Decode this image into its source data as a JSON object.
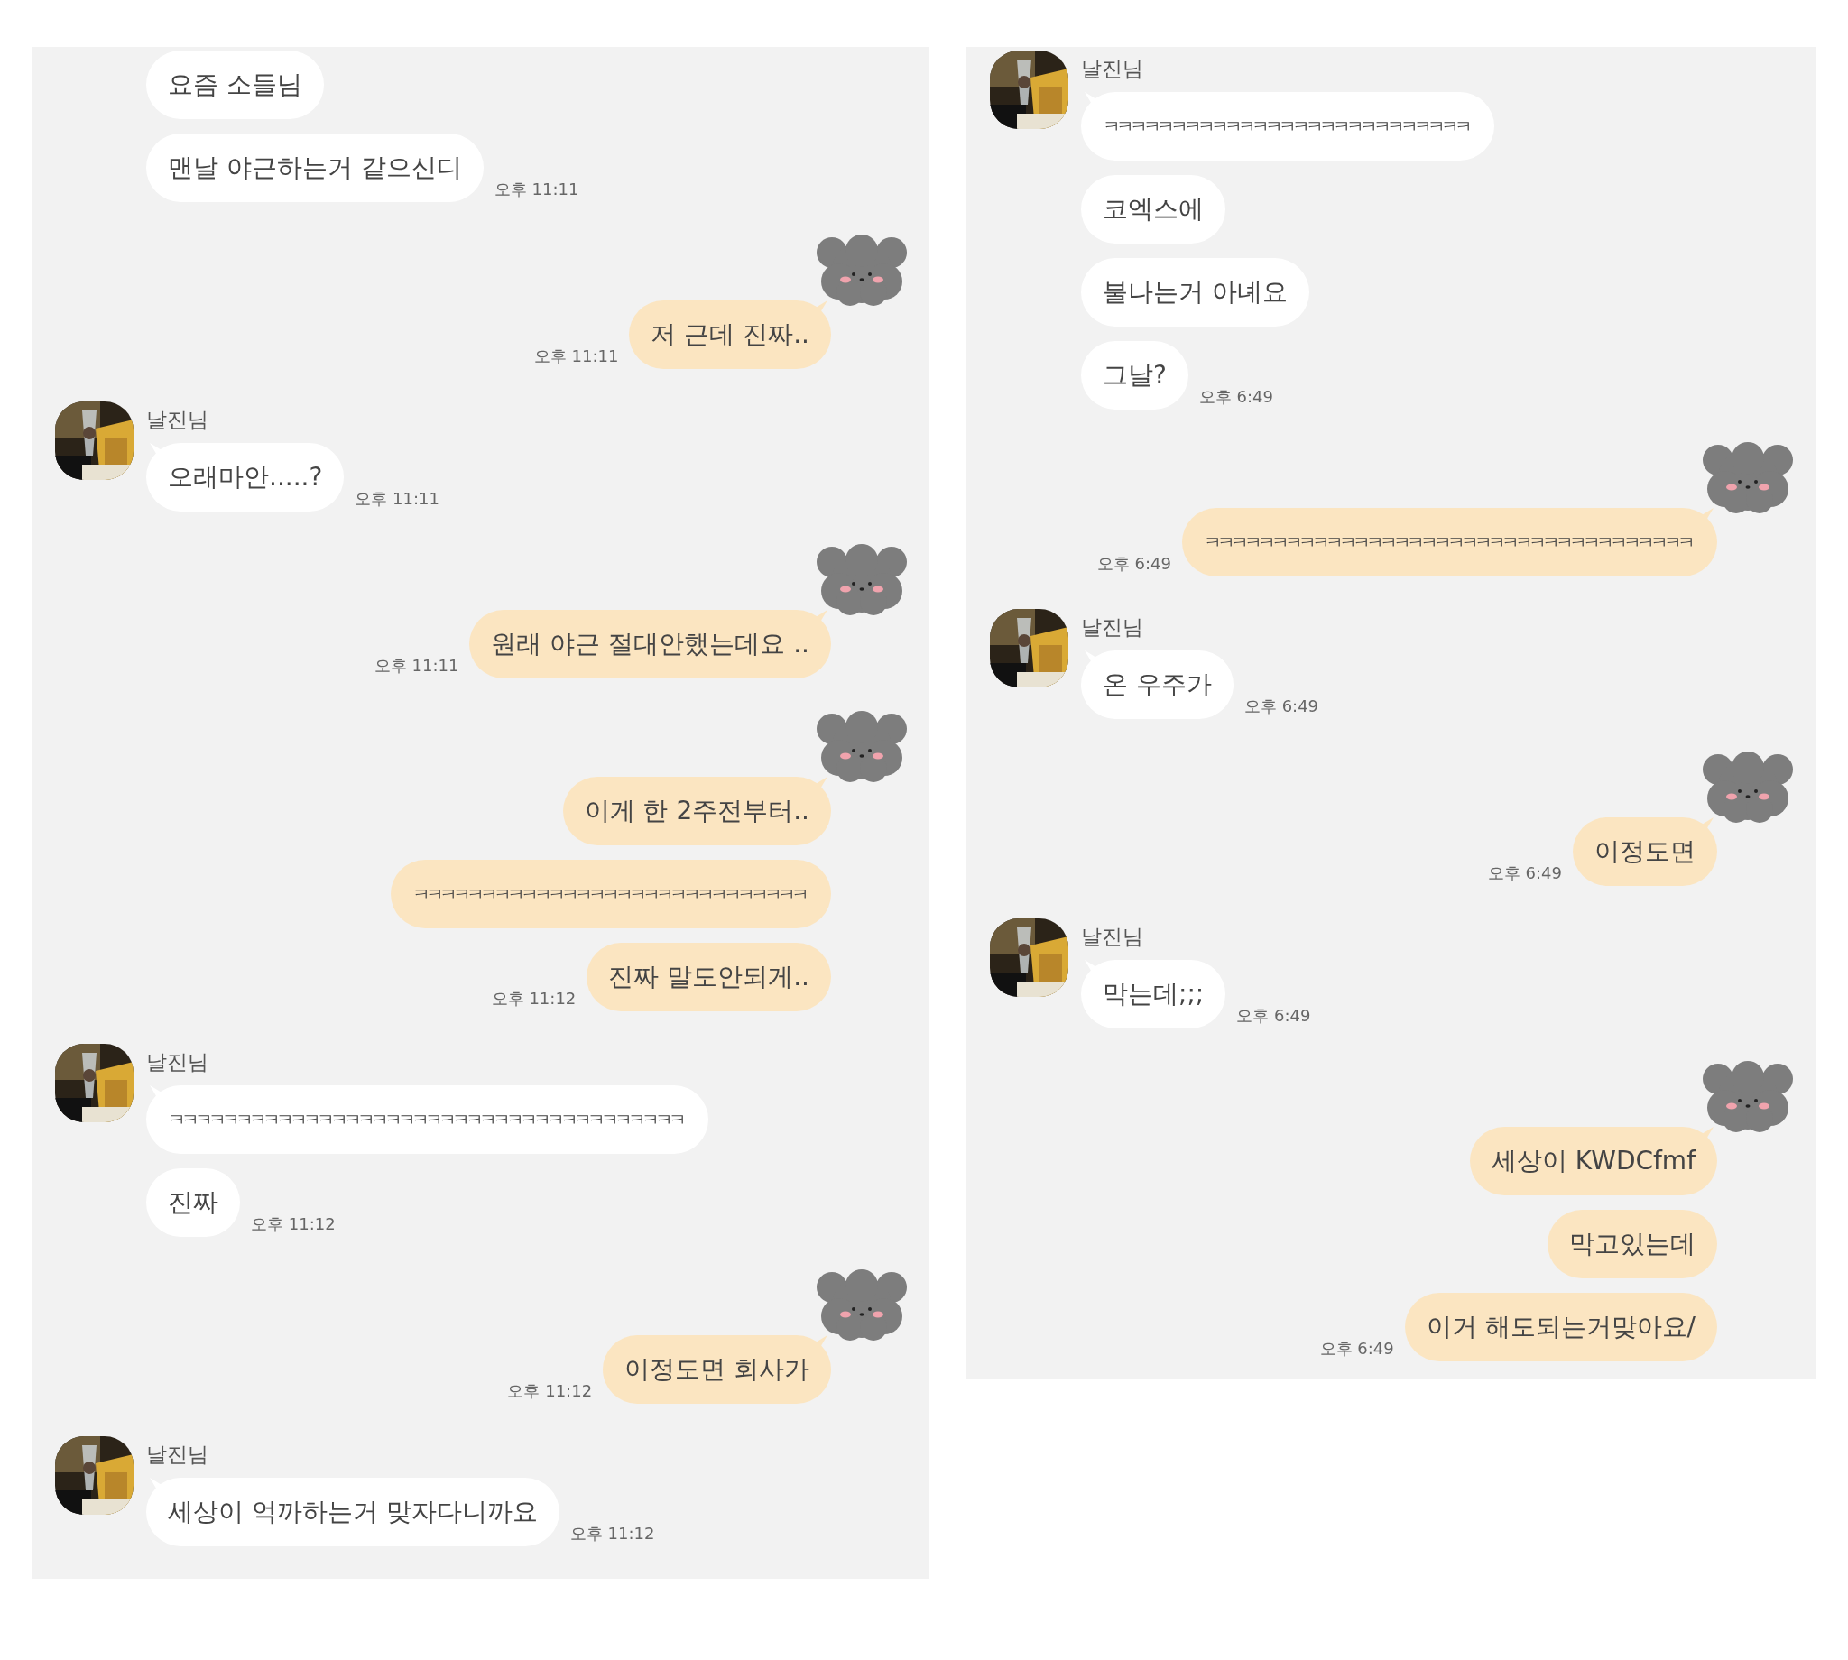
{
  "panels": [
    {
      "groups": [
        {
          "kind": "received",
          "profile": false,
          "messages": [
            {
              "text": "요즘 소들님"
            },
            {
              "text": "맨날 야근하는거 같으신디",
              "time": "오후 11:11"
            }
          ]
        },
        {
          "kind": "sent",
          "profile": true,
          "messages": [
            {
              "text": "저 근데 진짜..",
              "time": "오후 11:11"
            }
          ]
        },
        {
          "kind": "received",
          "profile": true,
          "name": "날진님",
          "messages": [
            {
              "text": "오래마안.....?",
              "time": "오후 11:11"
            }
          ]
        },
        {
          "kind": "sent",
          "profile": true,
          "messages": [
            {
              "text": "원래 야근 절대안했는데요 ..",
              "time": "오후 11:11"
            }
          ]
        },
        {
          "kind": "sent",
          "profile": true,
          "messages": [
            {
              "text": "이게 한 2주전부터.."
            },
            {
              "text": "ㅋㅋㅋㅋㅋㅋㅋㅋㅋㅋㅋㅋㅋㅋㅋㅋㅋㅋㅋㅋㅋㅋㅋㅋㅋㅋㅋㅋㅋ",
              "kind": "laugh"
            },
            {
              "text": "진짜 말도안되게..",
              "time": "오후 11:12"
            }
          ]
        },
        {
          "kind": "received",
          "profile": true,
          "name": "날진님",
          "messages": [
            {
              "text": "ㅋㅋㅋㅋㅋㅋㅋㅋㅋㅋㅋㅋㅋㅋㅋㅋㅋㅋㅋㅋㅋㅋㅋㅋㅋㅋㅋㅋㅋㅋㅋㅋㅋㅋㅋㅋㅋㅋ",
              "kind": "laugh"
            },
            {
              "text": "진짜",
              "time": "오후 11:12"
            }
          ]
        },
        {
          "kind": "sent",
          "profile": true,
          "messages": [
            {
              "text": "이정도면 회사가",
              "time": "오후 11:12"
            }
          ]
        },
        {
          "kind": "received",
          "profile": true,
          "name": "날진님",
          "messages": [
            {
              "text": "세상이 억까하는거 맞자다니까요",
              "time": "오후 11:12"
            }
          ]
        }
      ]
    },
    {
      "groups": [
        {
          "kind": "received",
          "profile": true,
          "name": "날진님",
          "messages": [
            {
              "text": "ㅋㅋㅋㅋㅋㅋㅋㅋㅋㅋㅋㅋㅋㅋㅋㅋㅋㅋㅋㅋㅋㅋㅋㅋㅋㅋㅋ",
              "kind": "laugh"
            },
            {
              "text": "코엑스에"
            },
            {
              "text": "불나는거 아녜요"
            },
            {
              "text": "그날?",
              "time": "오후 6:49"
            }
          ]
        },
        {
          "kind": "sent",
          "profile": true,
          "messages": [
            {
              "text": "ㅋㅋㅋㅋㅋㅋㅋㅋㅋㅋㅋㅋㅋㅋㅋㅋㅋㅋㅋㅋㅋㅋㅋㅋㅋㅋㅋㅋㅋㅋㅋㅋㅋㅋㅋㅋ",
              "kind": "laugh",
              "time": "오후 6:49"
            }
          ]
        },
        {
          "kind": "received",
          "profile": true,
          "name": "날진님",
          "messages": [
            {
              "text": "온 우주가",
              "time": "오후 6:49"
            }
          ]
        },
        {
          "kind": "sent",
          "profile": true,
          "messages": [
            {
              "text": "이정도면",
              "time": "오후 6:49"
            }
          ]
        },
        {
          "kind": "received",
          "profile": true,
          "name": "날진님",
          "messages": [
            {
              "text": "막는데;;;",
              "time": "오후 6:49"
            }
          ]
        },
        {
          "kind": "sent",
          "profile": true,
          "messages": [
            {
              "text": "세상이 KWDCfmf"
            },
            {
              "text": "막고있는데"
            },
            {
              "text": "이거 해도되는거맞아요/",
              "time": "오후 6:49"
            }
          ]
        }
      ]
    }
  ]
}
